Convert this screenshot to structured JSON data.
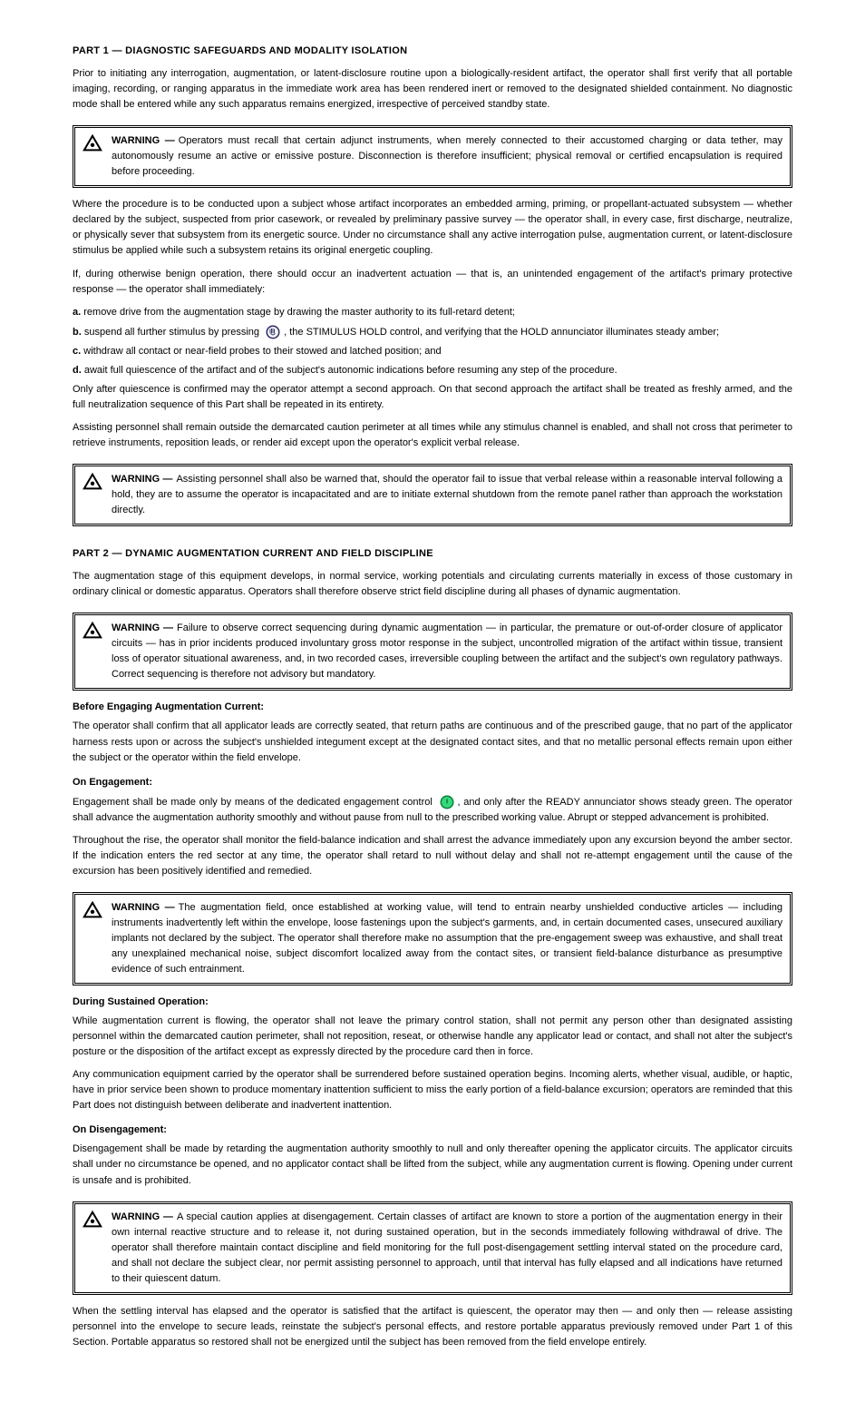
{
  "header": {
    "section1_title": "PART 1 — DIAGNOSTIC SAFEGUARDS AND MODALITY ISOLATION",
    "section2_title": "PART 2 — DYNAMIC AUGMENTATION CURRENT AND FIELD DISCIPLINE"
  },
  "s1": {
    "p1": "Prior to initiating any interrogation, augmentation, or latent-disclosure routine upon a biologically-resident artifact, the operator shall first verify that all portable imaging, recording, or ranging apparatus in the immediate work area has been rendered inert or removed to the designated shielded containment. No diagnostic mode shall be entered while any such apparatus remains energized, irrespective of perceived standby state.",
    "warn1": "Operators must recall that certain adjunct instruments, when merely connected to their accustomed charging or data tether, may autonomously resume an active or emissive posture. Disconnection is therefore insufficient; physical removal or certified encapsulation is required before proceeding.",
    "p2": "Where the procedure is to be conducted upon a subject whose artifact incorporates an embedded arming, priming, or propellant-actuated subsystem — whether declared by the subject, suspected from prior casework, or revealed by preliminary passive survey — the operator shall, in every case, first discharge, neutralize, or physically sever that subsystem from its energetic source. Under no circumstance shall any active interrogation pulse, augmentation current, or latent-disclosure stimulus be applied while such a subsystem retains its original energetic coupling.",
    "p3": "If, during otherwise benign operation, there should occur an inadvertent actuation — that is, an unintended engagement of the artifact's primary protective response — the operator shall immediately:",
    "step_a": "remove drive from the augmentation stage by drawing the master authority to its full-retard detent;",
    "step_b_pre": "suspend all further stimulus by pressing ",
    "step_b_post": ", the STIMULUS HOLD control, and verifying that the HOLD annunciator illuminates steady amber;",
    "step_c": "withdraw all contact or near-field probes to their stowed and latched position; and",
    "step_d": "await full quiescence of the artifact and of the subject's autonomic indications before resuming any step of the procedure.",
    "only_after": "Only after quiescence is confirmed may the operator attempt a second approach. On that second approach the artifact shall be treated as freshly armed, and the full neutralization sequence of this Part shall be repeated in its entirety.",
    "assistants": "Assisting personnel shall remain outside the demarcated caution perimeter at all times while any stimulus channel is enabled, and shall not cross that perimeter to retrieve instruments, reposition leads, or render aid except upon the operator's explicit verbal release.",
    "warn1b": "Assisting personnel shall also be warned that, should the operator fail to issue that verbal release within a reasonable interval following a hold, they are to assume the operator is incapacitated and are to initiate external shutdown from the remote panel rather than approach the workstation directly."
  },
  "s2": {
    "intro": "The augmentation stage of this equipment develops, in normal service, working potentials and circulating currents materially in excess of those customary in ordinary clinical or domestic apparatus. Operators shall therefore observe strict field discipline during all phases of dynamic augmentation.",
    "warn2": "Failure to observe correct sequencing during dynamic augmentation — in particular, the premature or out-of-order closure of applicator circuits — has in prior incidents produced involuntary gross motor response in the subject, uncontrolled migration of the artifact within tissue, transient loss of operator situational awareness, and, in two recorded cases, irreversible coupling between the artifact and the subject's own regulatory pathways. Correct sequencing is therefore not advisory but mandatory.",
    "pre_eng": "Before Engaging Augmentation Current:",
    "pre_eng_text": "The operator shall confirm that all applicator leads are correctly seated, that return paths are continuous and of the prescribed gauge, that no part of the applicator harness rests upon or across the subject's unshielded integument except at the designated contact sites, and that no metallic personal effects remain upon either the subject or the operator within the field envelope.",
    "on_eng": "On Engagement:",
    "on_eng_step1_pre": "Engagement shall be made only by means of the dedicated engagement control ",
    "on_eng_step1_post": ", and only after the READY annunciator shows steady green. The operator shall advance the augmentation authority smoothly and without pause from null to the prescribed working value. Abrupt or stepped advancement is prohibited.",
    "on_eng_step2": "Throughout the rise, the operator shall monitor the field-balance indication and shall arrest the advance immediately upon any excursion beyond the amber sector. If the indication enters the red sector at any time, the operator shall retard to null without delay and shall not re-attempt engagement until the cause of the excursion has been positively identified and remedied.",
    "warn3": "The augmentation field, once established at working value, will tend to entrain nearby unshielded conductive articles — including instruments inadvertently left within the envelope, loose fastenings upon the subject's garments, and, in certain documented cases, unsecured auxiliary implants not declared by the subject. The operator shall therefore make no assumption that the pre-engagement sweep was exhaustive, and shall treat any unexplained mechanical noise, subject discomfort localized away from the contact sites, or transient field-balance disturbance as presumptive evidence of such entrainment.",
    "during": "During Sustained Operation:",
    "during_text": "While augmentation current is flowing, the operator shall not leave the primary control station, shall not permit any person other than designated assisting personnel within the demarcated caution perimeter, shall not reposition, reseat, or otherwise handle any applicator lead or contact, and shall not alter the subject's posture or the disposition of the artifact except as expressly directed by the procedure card then in force.",
    "during_text2": "Any communication equipment carried by the operator shall be surrendered before sustained operation begins. Incoming alerts, whether visual, audible, or haptic, have in prior service been shown to produce momentary inattention sufficient to miss the early portion of a field-balance excursion; operators are reminded that this Part does not distinguish between deliberate and inadvertent inattention.",
    "on_diseng": "On Disengagement:",
    "on_diseng_text": "Disengagement shall be made by retarding the augmentation authority smoothly to null and only thereafter opening the applicator circuits. The applicator circuits shall under no circumstance be opened, and no applicator contact shall be lifted from the subject, while any augmentation current is flowing. Opening under current is unsafe and is prohibited.",
    "warn4": "A special caution applies at disengagement. Certain classes of artifact are known to store a portion of the augmentation energy in their own internal reactive structure and to release it, not during sustained operation, but in the seconds immediately following withdrawal of drive. The operator shall therefore maintain contact discipline and field monitoring for the full post-disengagement settling interval stated on the procedure card, and shall not declare the subject clear, nor permit assisting personnel to approach, until that interval has fully elapsed and all indications have returned to their quiescent datum.",
    "final": "When the settling interval has elapsed and the operator is satisfied that the artifact is quiescent, the operator may then — and only then — release assisting personnel into the envelope to secure leads, reinstate the subject's personal effects, and restore portable apparatus previously removed under Part 1 of this Section. Portable apparatus so restored shall not be energized until the subject has been removed from the field envelope entirely."
  },
  "labels": {
    "step_a": "a.",
    "step_b": "b.",
    "step_c": "c.",
    "step_d": "d.",
    "hold_button_name": "STIMULUS HOLD",
    "engage_button_name": "ENGAGE",
    "warning_word": "WARNING —"
  }
}
